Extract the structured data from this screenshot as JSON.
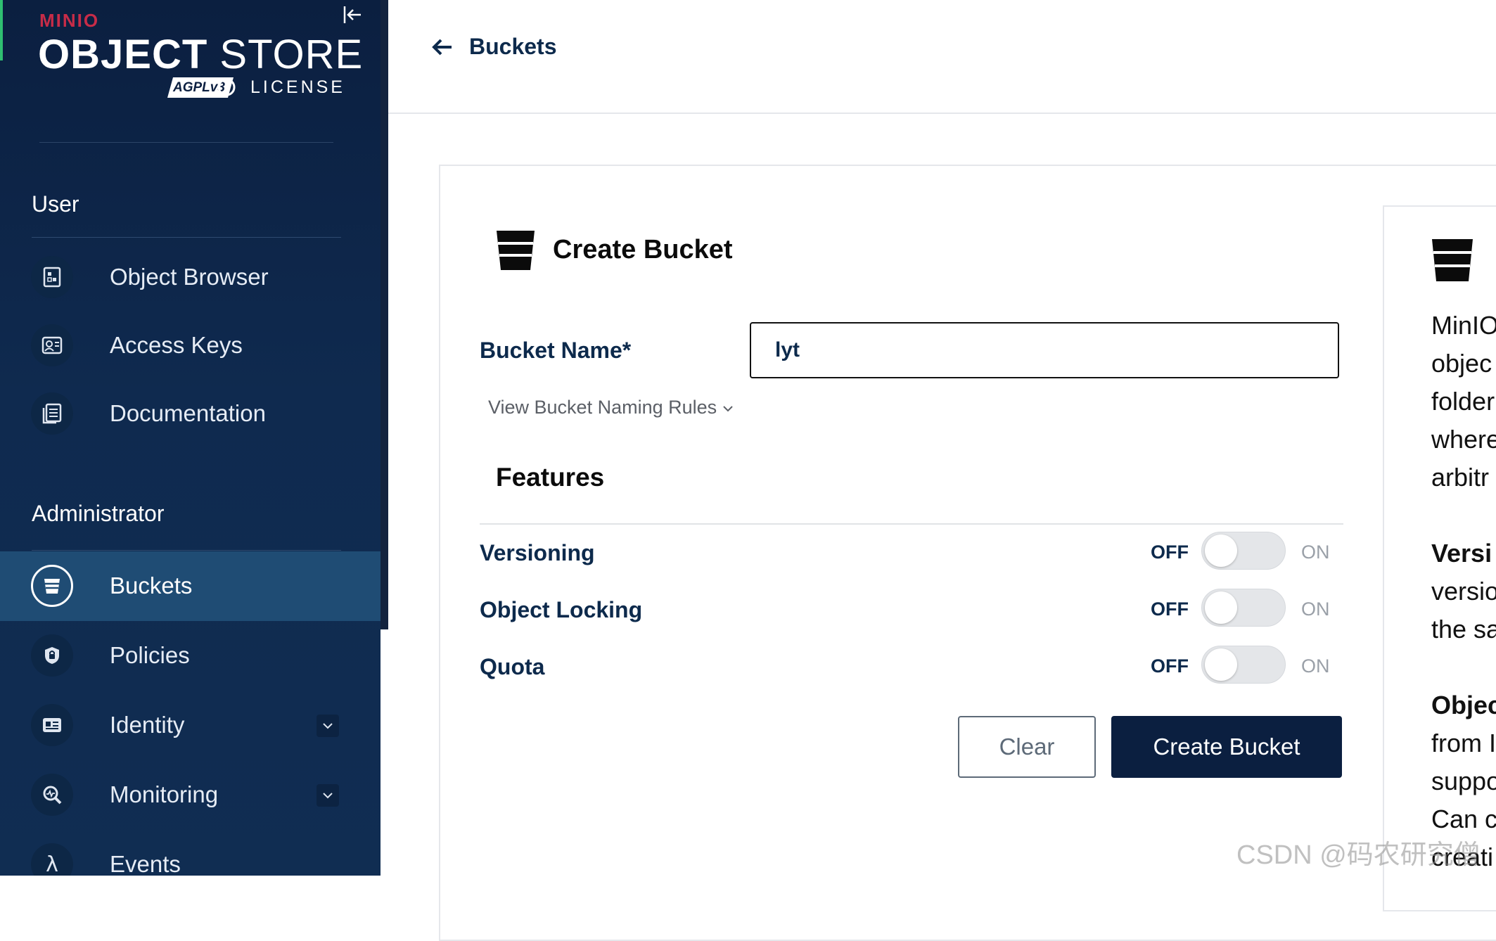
{
  "sidebar": {
    "logo": {
      "brand": "MINIO",
      "title_bold": "OBJECT",
      "title_light": "STORE",
      "badge": "AGPLv3",
      "license": "LICENSE"
    },
    "user_section_label": "User",
    "admin_section_label": "Administrator",
    "user_items": [
      {
        "label": "Object Browser",
        "icon": "object-browser-icon"
      },
      {
        "label": "Access Keys",
        "icon": "access-keys-icon"
      },
      {
        "label": "Documentation",
        "icon": "documentation-icon"
      }
    ],
    "admin_items": [
      {
        "label": "Buckets",
        "icon": "bucket-icon",
        "active": true
      },
      {
        "label": "Policies",
        "icon": "shield-icon"
      },
      {
        "label": "Identity",
        "icon": "identity-icon",
        "expandable": true
      },
      {
        "label": "Monitoring",
        "icon": "monitoring-icon",
        "expandable": true
      },
      {
        "label": "Events",
        "icon": "lambda-icon"
      }
    ]
  },
  "header": {
    "back_label": "Buckets"
  },
  "form": {
    "title": "Create Bucket",
    "bucket_name_label": "Bucket Name*",
    "bucket_name_value": "lyt",
    "naming_rules_link": "View Bucket Naming Rules",
    "features_title": "Features",
    "features": [
      {
        "label": "Versioning",
        "off": "OFF",
        "on": "ON",
        "enabled": false
      },
      {
        "label": "Object Locking",
        "off": "OFF",
        "on": "ON",
        "enabled": false
      },
      {
        "label": "Quota",
        "off": "OFF",
        "on": "ON",
        "enabled": false
      }
    ],
    "clear_button": "Clear",
    "create_button": "Create Bucket"
  },
  "help_panel": {
    "lines": [
      {
        "text": "MinIO",
        "bold": false
      },
      {
        "text": "objec",
        "bold": false
      },
      {
        "text": "folder",
        "bold": false
      },
      {
        "text": "where",
        "bold": false
      },
      {
        "text": "arbitr",
        "bold": false
      },
      {
        "text": "Versi",
        "bold": true
      },
      {
        "text": "versio",
        "bold": false
      },
      {
        "text": "the sa",
        "bold": false
      },
      {
        "text": "Objec",
        "bold": true
      },
      {
        "text": "from I",
        "bold": false
      },
      {
        "text": "suppo",
        "bold": false
      },
      {
        "text": "Can c",
        "bold": false
      },
      {
        "text": "creati",
        "bold": false
      }
    ]
  },
  "watermark": "CSDN @码农研究僧",
  "colors": {
    "sidebar_bg": "#0f2a4f",
    "active_item": "#1f4c74",
    "primary_button": "#0b1f40",
    "brand_red": "#c72c48",
    "text_navy": "#0d2a4c"
  }
}
